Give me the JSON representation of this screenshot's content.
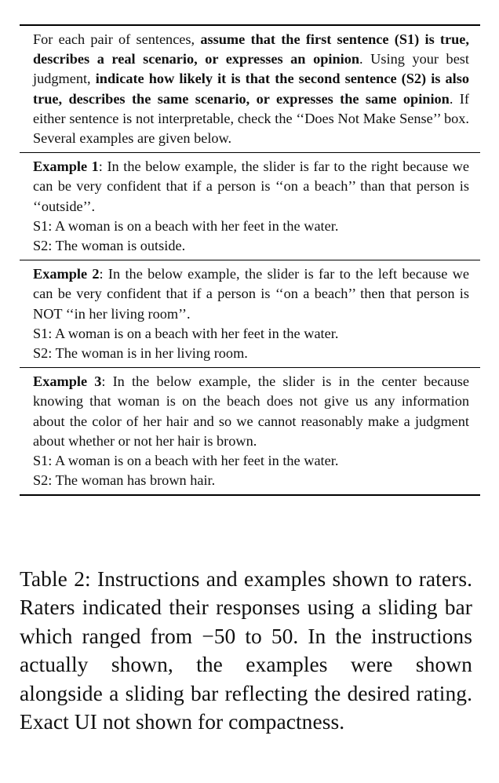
{
  "instructions": {
    "t1": "For each pair of sentences,",
    "b1": "assume that the first sentence (S1) is true, describes a real scenario, or expresses an opinion",
    "t2": ". Using your best judgment,",
    "b2": "indicate how likely it is that the second sentence (S2) is also true, describes the same scenario, or expresses the same opinion",
    "t3": ". If either sentence is not interpretable, check the ‘‘Does Not Make Sense’’ box. Several examples are given below."
  },
  "examples": [
    {
      "title": "Example 1",
      "body": ": In the below example, the slider is far to the right because we can be very confident that if a person is ‘‘on a beach’’ than that person is ‘‘outside’’.",
      "s1": "S1: A woman is on a beach with her feet in the water.",
      "s2": "S2: The woman is outside."
    },
    {
      "title": "Example 2",
      "body": ": In the below example, the slider is far to the left because we can be very confident that if a person is ‘‘on a beach’’ then that person is NOT ‘‘in her living room’’.",
      "s1": "S1: A woman is on a beach with her feet in the water.",
      "s2": "S2: The woman is in her living room."
    },
    {
      "title": "Example 3",
      "body": ": In the below example, the slider is in the center because knowing that woman is on the beach does not give us any information about the color of her hair and so we cannot reasonably make a judgment about whether or not her hair is brown.",
      "s1": "S1: A woman is on a beach with her feet in the water.",
      "s2": "S2: The woman has brown hair."
    }
  ],
  "caption": "Table 2: Instructions and examples shown to raters. Raters indicated their responses using a sliding bar which ranged from −50 to 50. In the instructions actually shown, the examples were shown alongside a sliding bar reflecting the desired rating. Exact UI not shown for compactness."
}
